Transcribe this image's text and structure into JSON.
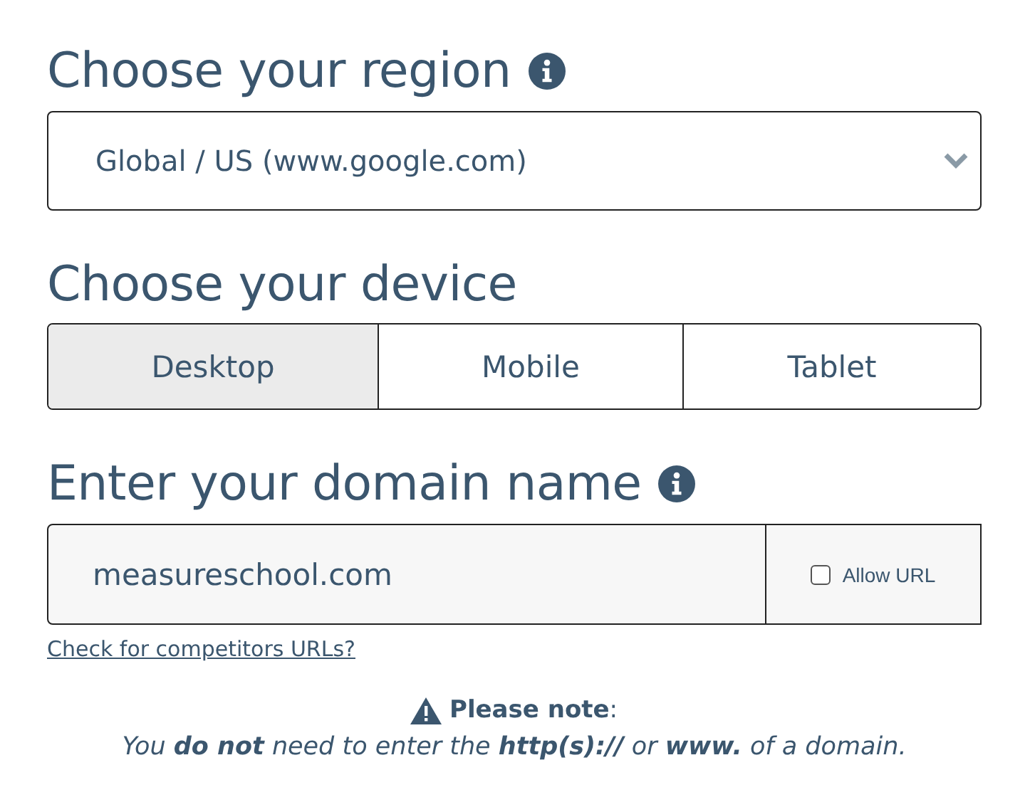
{
  "region": {
    "heading": "Choose your region",
    "value": "Global / US (www.google.com)"
  },
  "device": {
    "heading": "Choose your device",
    "tabs": [
      {
        "label": "Desktop",
        "selected": true
      },
      {
        "label": "Mobile",
        "selected": false
      },
      {
        "label": "Tablet",
        "selected": false
      }
    ]
  },
  "domain": {
    "heading": "Enter your domain name",
    "value": "measureschool.com",
    "allow_url": {
      "label": "Allow URL",
      "checked": false
    },
    "link": "Check for competitors URLs?"
  },
  "note": {
    "title": "**Please note**:",
    "text": "You **do not** need to enter the **http(s)://** or **www.** of a domain."
  }
}
